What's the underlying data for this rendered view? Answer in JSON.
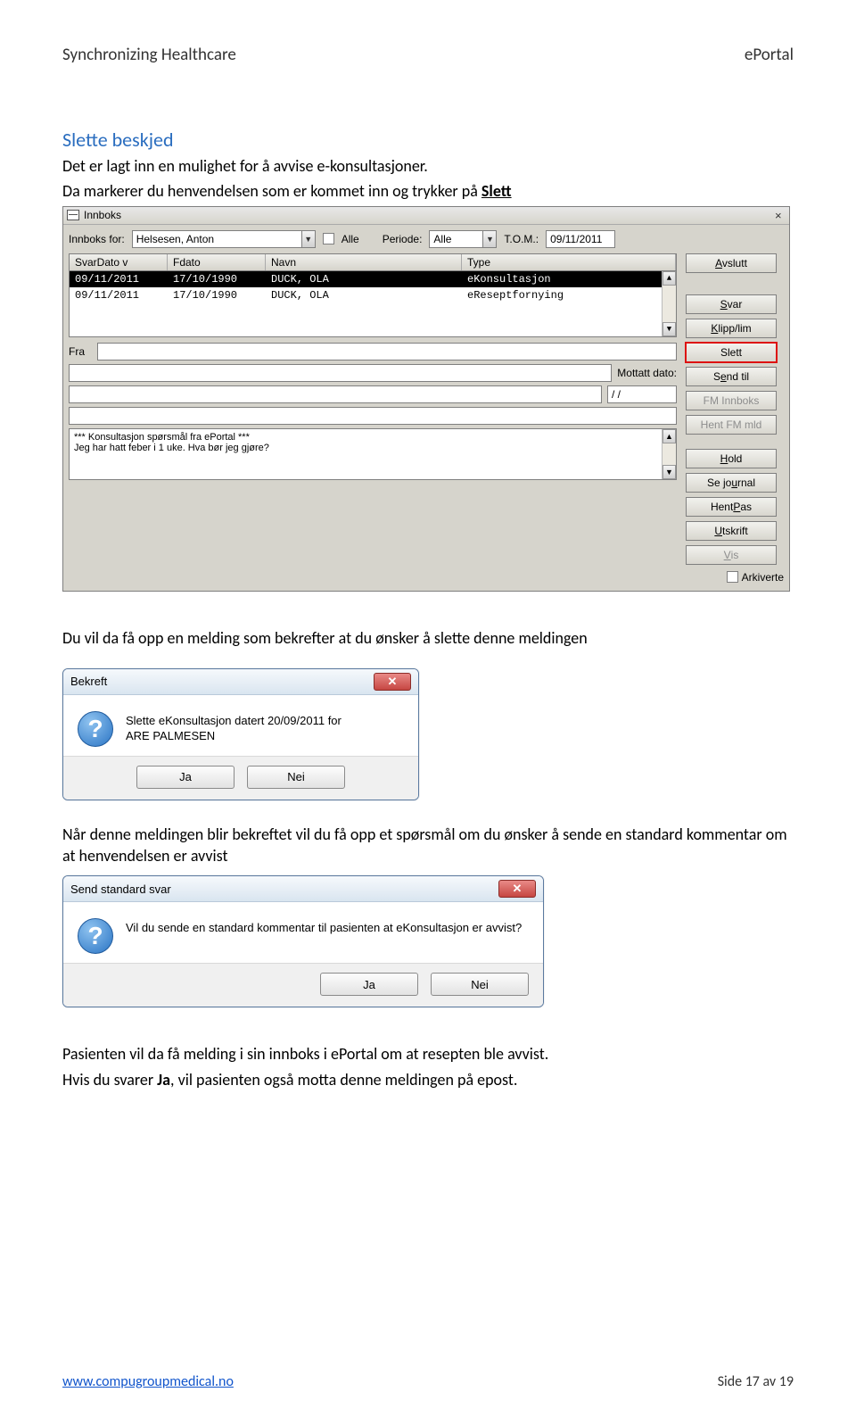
{
  "header": {
    "left": "Synchronizing Healthcare",
    "right": "ePortal"
  },
  "section_title": "Slette beskjed",
  "intro_line": "Det er lagt inn en mulighet for å avvise e-konsultasjoner.",
  "line2_pre": "Da markerer du henvendelsen som er kommet inn og trykker på ",
  "line2_bold": "Slett",
  "innboks": {
    "title": "Innboks",
    "labels": {
      "innboks_for": "Innboks for:",
      "alle": "Alle",
      "periode": "Periode:",
      "tom": "T.O.M.:",
      "fra": "Fra",
      "mottatt_dato": "Mottatt dato:",
      "arkiverte": "Arkiverte"
    },
    "fields": {
      "user": "Helsesen, Anton",
      "periode_val": "Alle",
      "tom_val": "09/11/2011",
      "mottatt_val": "/  /"
    },
    "columns": {
      "svardato": "SvarDato  v",
      "fdato": "Fdato",
      "navn": "Navn",
      "type": "Type"
    },
    "rows": [
      {
        "svardato": "09/11/2011",
        "fdato": "17/10/1990",
        "navn": "DUCK, OLA",
        "type": "eKonsultasjon",
        "selected": true
      },
      {
        "svardato": "09/11/2011",
        "fdato": "17/10/1990",
        "navn": "DUCK, OLA",
        "type": "eReseptfornying",
        "selected": false
      }
    ],
    "buttons": {
      "avslutt": "Avslutt",
      "svar": "Svar",
      "klipp": "Klipp/lim",
      "slett": "Slett",
      "sendtil": "Send til",
      "fminnboks": "FM Innboks",
      "hentfm": "Hent FM mld",
      "hold": "Hold",
      "sejournal": "Se journal",
      "hentpas": "Hent Pas",
      "utskrift": "Utskrift",
      "vis": "Vis"
    },
    "msgbox": "*** Konsultasjon spørsmål  fra ePortal ***\nJeg har hatt feber i 1 uke. Hva bør jeg gjøre?"
  },
  "mid_text": "Du vil da få opp en melding som bekrefter at du ønsker å slette denne meldingen",
  "dlg1": {
    "title": "Bekreft",
    "text": "Slette eKonsultasjon datert 20/09/2011 for\nARE PALMESEN",
    "yes": "Ja",
    "no": "Nei"
  },
  "mid_text2": "Når denne meldingen blir bekreftet vil du få opp et spørsmål om du ønsker å sende en standard kommentar om at henvendelsen er avvist",
  "dlg2": {
    "title": "Send standard svar",
    "text": "Vil du sende en standard kommentar til pasienten at eKonsultasjon er avvist?",
    "yes": "Ja",
    "no": "Nei"
  },
  "tail1": "Pasienten vil da få melding i sin innboks i ePortal om at resepten ble avvist.",
  "tail2_pre": "Hvis du svarer ",
  "tail2_bold": "Ja",
  "tail2_post": ", vil pasienten også motta denne meldingen på epost.",
  "footer": {
    "url": "www.compugroupmedical.no",
    "page": "Side 17 av 19"
  }
}
